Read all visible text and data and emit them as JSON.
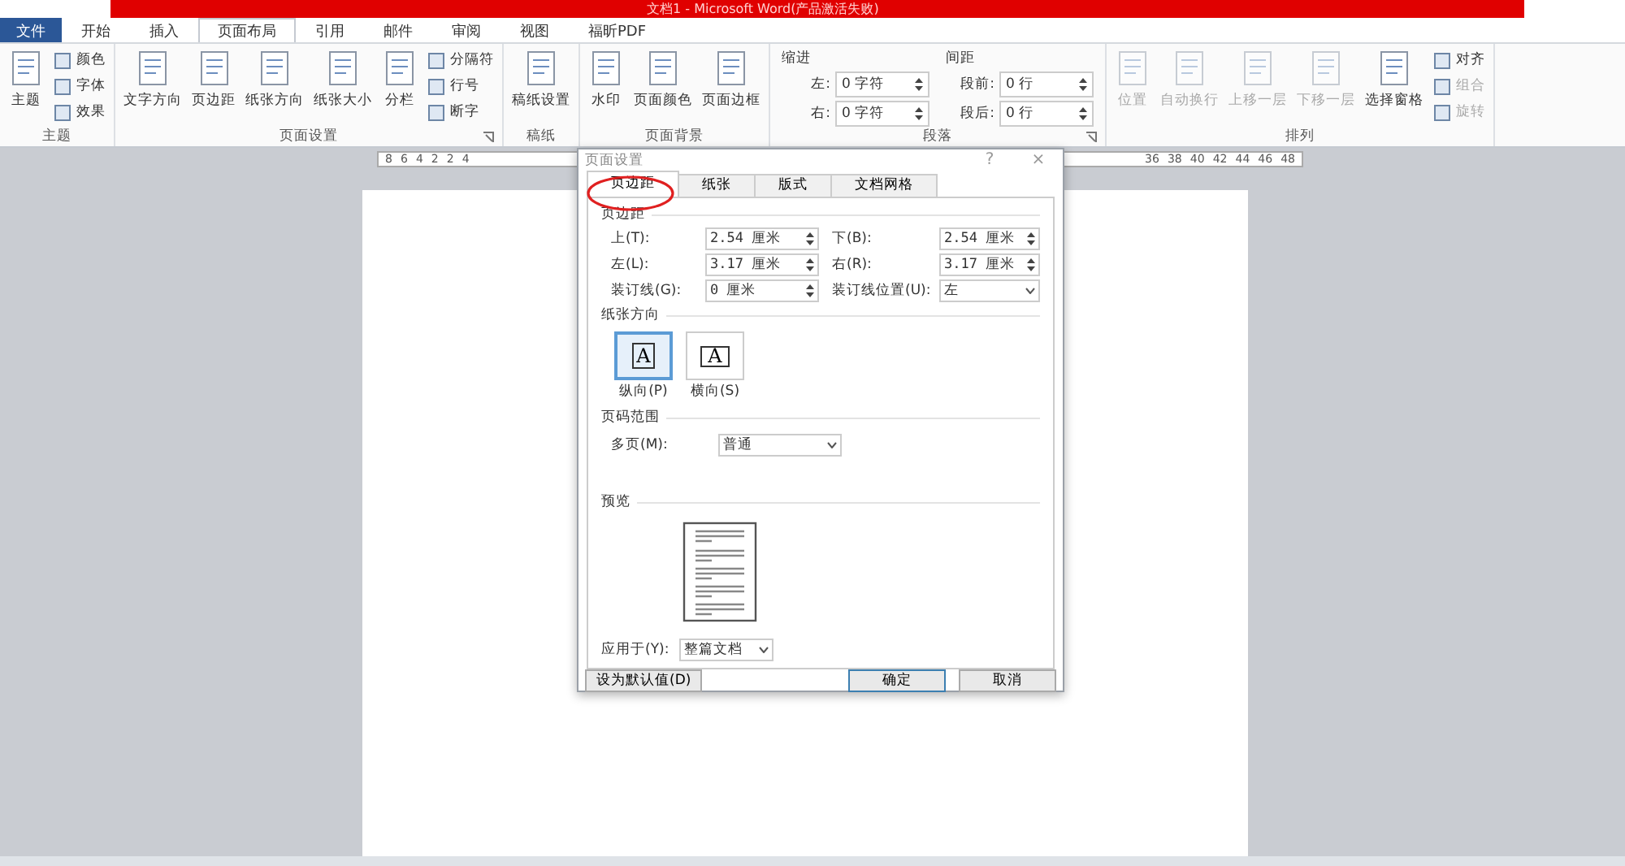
{
  "window": {
    "title": "文档1 - Microsoft Word(产品激活失败)"
  },
  "tabs": [
    {
      "label": "文件",
      "kind": "file",
      "selected": false
    },
    {
      "label": "开始",
      "kind": "tab",
      "selected": false
    },
    {
      "label": "插入",
      "kind": "tab",
      "selected": false
    },
    {
      "label": "页面布局",
      "kind": "tab",
      "selected": true
    },
    {
      "label": "引用",
      "kind": "tab",
      "selected": false
    },
    {
      "label": "邮件",
      "kind": "tab",
      "selected": false
    },
    {
      "label": "审阅",
      "kind": "tab",
      "selected": false
    },
    {
      "label": "视图",
      "kind": "tab",
      "selected": false
    },
    {
      "label": "福昕PDF",
      "kind": "tab",
      "selected": false
    }
  ],
  "ribbon": [
    {
      "label": "主题",
      "launcher": false,
      "items": [
        {
          "kind": "large",
          "label": "主题",
          "disabled": false
        },
        {
          "kind": "stack",
          "entries": [
            {
              "label": "颜色",
              "disabled": false
            },
            {
              "label": "字体",
              "disabled": false
            },
            {
              "label": "效果",
              "disabled": false
            }
          ]
        }
      ]
    },
    {
      "label": "页面设置",
      "launcher": true,
      "items": [
        {
          "kind": "large",
          "label": "文字方向",
          "disabled": false
        },
        {
          "kind": "large",
          "label": "页边距",
          "disabled": false
        },
        {
          "kind": "large",
          "label": "纸张方向",
          "disabled": false
        },
        {
          "kind": "large",
          "label": "纸张大小",
          "disabled": false
        },
        {
          "kind": "large",
          "label": "分栏",
          "disabled": false
        },
        {
          "kind": "stack",
          "entries": [
            {
              "label": "分隔符",
              "disabled": false
            },
            {
              "label": "行号",
              "disabled": false
            },
            {
              "label": "断字",
              "disabled": false
            }
          ]
        }
      ]
    },
    {
      "label": "稿纸",
      "launcher": false,
      "items": [
        {
          "kind": "large",
          "label": "稿纸设置",
          "disabled": false
        }
      ]
    },
    {
      "label": "页面背景",
      "launcher": false,
      "items": [
        {
          "kind": "large",
          "label": "水印",
          "disabled": false
        },
        {
          "kind": "large",
          "label": "页面颜色",
          "disabled": false
        },
        {
          "kind": "large",
          "label": "页面边框",
          "disabled": false
        }
      ]
    },
    {
      "label": "段落",
      "launcher": true,
      "items": [
        {
          "kind": "spins",
          "title": "缩进",
          "entries": [
            {
              "label": "左:",
              "value": "0 字符"
            },
            {
              "label": "右:",
              "value": "0 字符"
            }
          ]
        },
        {
          "kind": "spins",
          "title": "间距",
          "entries": [
            {
              "label": "段前:",
              "value": "0 行"
            },
            {
              "label": "段后:",
              "value": "0 行"
            }
          ]
        }
      ]
    },
    {
      "label": "排列",
      "launcher": false,
      "items": [
        {
          "kind": "large",
          "label": "位置",
          "disabled": true
        },
        {
          "kind": "large",
          "label": "自动换行",
          "disabled": true
        },
        {
          "kind": "large",
          "label": "上移一层",
          "disabled": true
        },
        {
          "kind": "large",
          "label": "下移一层",
          "disabled": true
        },
        {
          "kind": "large",
          "label": "选择窗格",
          "disabled": false
        },
        {
          "kind": "stack",
          "entries": [
            {
              "label": "对齐",
              "disabled": false
            },
            {
              "label": "组合",
              "disabled": true
            },
            {
              "label": "旋转",
              "disabled": true
            }
          ]
        }
      ]
    }
  ],
  "ruler": {
    "left_marks": [
      "8",
      "6",
      "4",
      "2",
      "2",
      "4"
    ],
    "right_marks": [
      "36",
      "38",
      "40",
      "42",
      "44",
      "46",
      "48"
    ]
  },
  "dialog": {
    "title": "页面设置",
    "help": "?",
    "close": "×",
    "tabs": [
      {
        "label": "页边距",
        "selected": true
      },
      {
        "label": "纸张",
        "selected": false
      },
      {
        "label": "版式",
        "selected": false
      },
      {
        "label": "文档网格",
        "selected": false
      }
    ],
    "margins_heading": "页边距",
    "margin_fields": [
      {
        "label": "上(T):",
        "value": "2.54 厘米"
      },
      {
        "label": "下(B):",
        "value": "2.54 厘米"
      },
      {
        "label": "左(L):",
        "value": "3.17 厘米"
      },
      {
        "label": "右(R):",
        "value": "3.17 厘米"
      },
      {
        "label": "装订线(G):",
        "value": "0 厘米"
      }
    ],
    "gutter_position": {
      "label": "装订线位置(U):",
      "value": "左"
    },
    "orientation_heading": "纸张方向",
    "orientations": [
      {
        "label": "纵向(P)",
        "glyph": "A",
        "selected": true
      },
      {
        "label": "横向(S)",
        "glyph": "A",
        "selected": false
      }
    ],
    "pages_heading": "页码范围",
    "multiple_pages": {
      "label": "多页(M):",
      "value": "普通"
    },
    "preview_heading": "预览",
    "apply_to": {
      "label": "应用于(Y):",
      "value": "整篇文档"
    },
    "buttons": [
      {
        "label": "设为默认值(D)",
        "kind": "left"
      },
      {
        "label": "确定",
        "kind": "default"
      },
      {
        "label": "取消",
        "kind": "normal"
      }
    ]
  }
}
